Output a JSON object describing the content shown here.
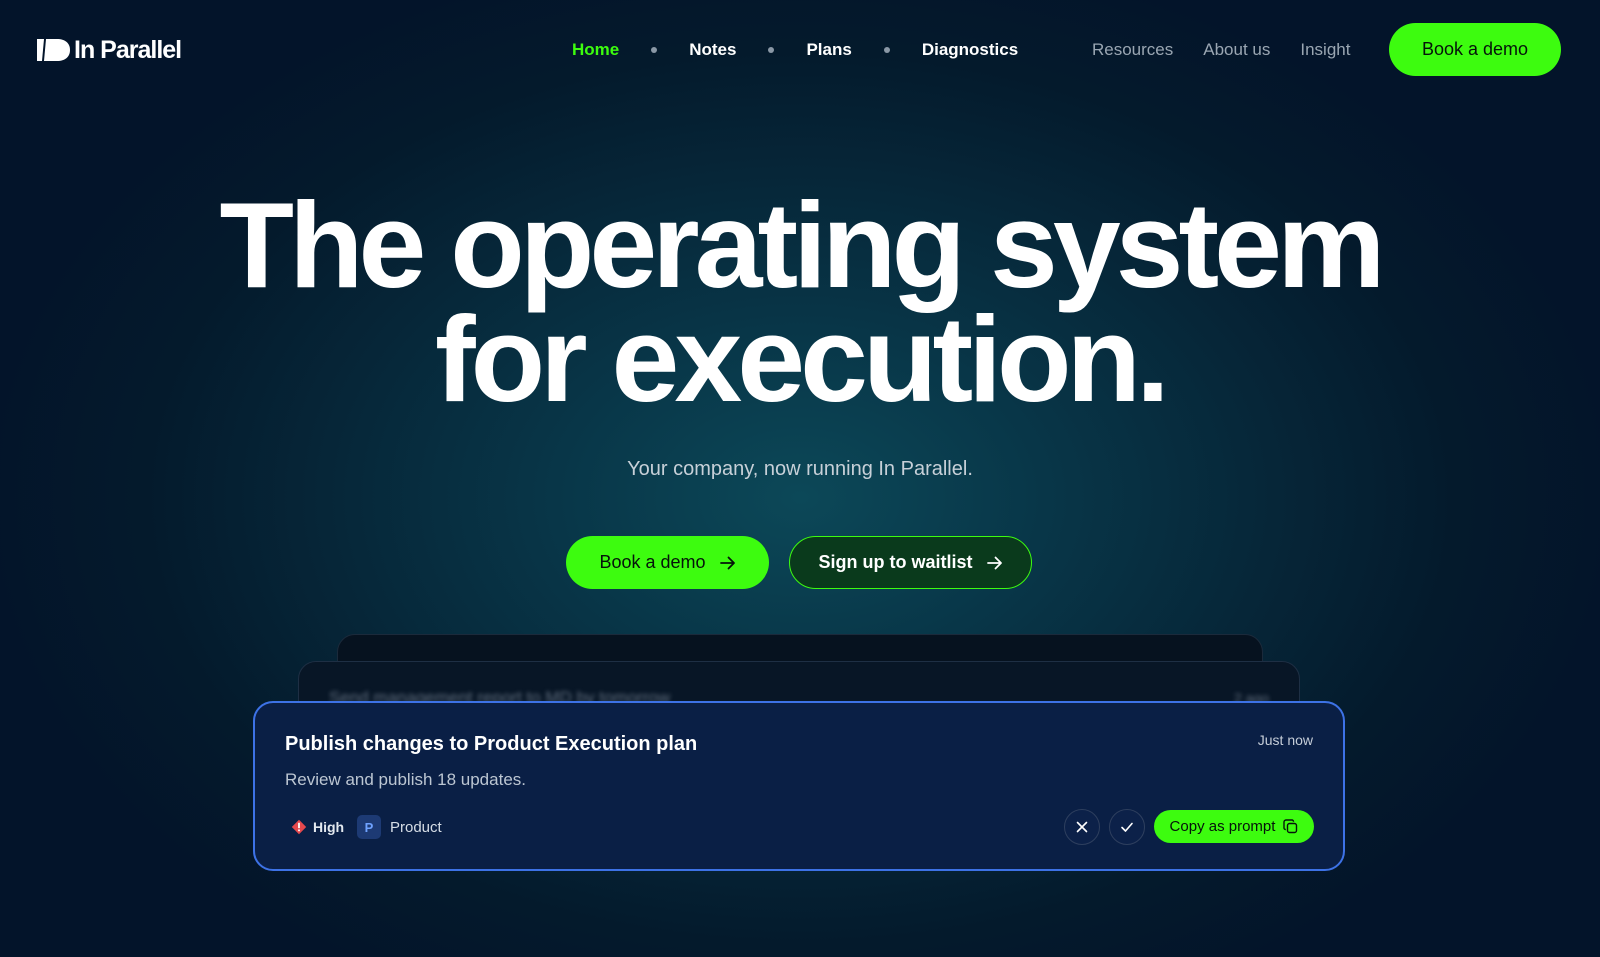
{
  "brand": {
    "name": "In Parallel"
  },
  "nav": {
    "primary": [
      {
        "label": "Home",
        "active": true
      },
      {
        "label": "Notes",
        "active": false
      },
      {
        "label": "Plans",
        "active": false
      },
      {
        "label": "Diagnostics",
        "active": false
      }
    ],
    "secondary": [
      {
        "label": "Resources"
      },
      {
        "label": "About us"
      },
      {
        "label": "Insight"
      }
    ],
    "cta_label": "Book a demo"
  },
  "hero": {
    "title_line1": "The operating system",
    "title_line2": "for execution.",
    "subtitle": "Your company, now running In Parallel.",
    "primary_cta": "Book a demo",
    "secondary_cta": "Sign up to waitlist"
  },
  "cards": {
    "background_item": {
      "text": "Send management report to MD by tomorrow",
      "time": "2 ago"
    },
    "main": {
      "title": "Publish changes to Product Execution plan",
      "time": "Just now",
      "description": "Review and publish 18 updates.",
      "priority": "High",
      "team_initial": "P",
      "team": "Product",
      "copy_label": "Copy as prompt"
    }
  },
  "colors": {
    "accent": "#3dfc0f",
    "card_border": "#3d72e6",
    "card_bg": "#0a1f45",
    "priority_high": "#e5484d"
  }
}
